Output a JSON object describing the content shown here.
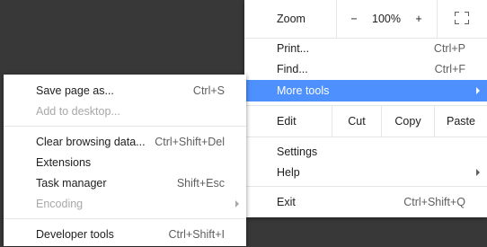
{
  "main_menu": {
    "zoom": {
      "label": "Zoom",
      "minus": "−",
      "level": "100%",
      "plus": "+",
      "fullscreen_icon": "fullscreen-icon"
    },
    "print": {
      "label": "Print...",
      "shortcut": "Ctrl+P"
    },
    "find": {
      "label": "Find...",
      "shortcut": "Ctrl+F"
    },
    "more_tools": {
      "label": "More tools"
    },
    "edit": {
      "label": "Edit",
      "cut": "Cut",
      "copy": "Copy",
      "paste": "Paste"
    },
    "settings": {
      "label": "Settings"
    },
    "help": {
      "label": "Help"
    },
    "exit": {
      "label": "Exit",
      "shortcut": "Ctrl+Shift+Q"
    }
  },
  "more_tools_submenu": {
    "save_page": {
      "label": "Save page as...",
      "shortcut": "Ctrl+S"
    },
    "add_to_desktop": {
      "label": "Add to desktop..."
    },
    "clear_browsing": {
      "label": "Clear browsing data...",
      "shortcut": "Ctrl+Shift+Del"
    },
    "extensions": {
      "label": "Extensions"
    },
    "task_manager": {
      "label": "Task manager",
      "shortcut": "Shift+Esc"
    },
    "encoding": {
      "label": "Encoding"
    },
    "developer_tools": {
      "label": "Developer tools",
      "shortcut": "Ctrl+Shift+I"
    }
  },
  "colors": {
    "highlight": "#4d90fe",
    "backdrop": "#383838",
    "disabled_text": "#a8a8a8"
  }
}
